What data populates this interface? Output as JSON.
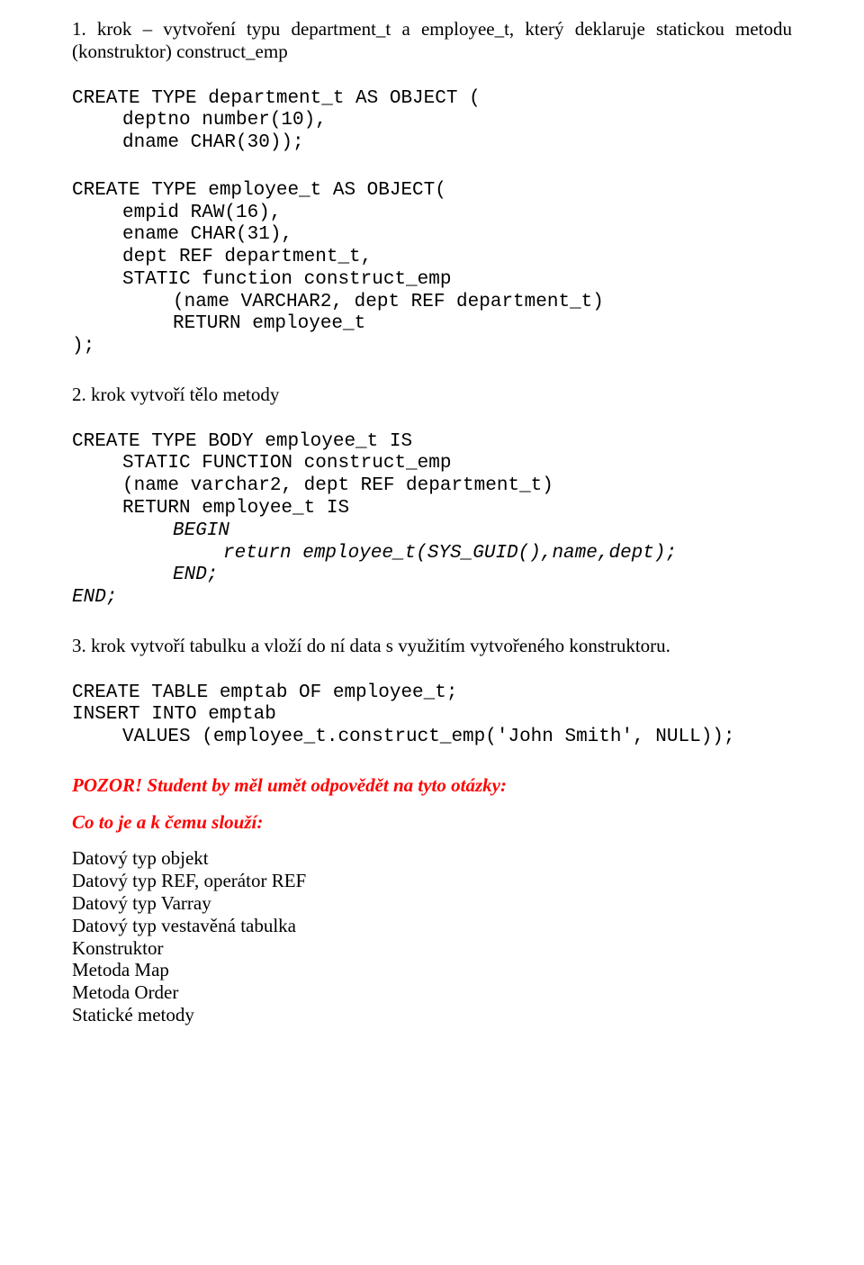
{
  "step1": {
    "intro": "1. krok – vytvoření typu department_t a employee_t, který deklaruje statickou metodu (konstruktor) construct_emp",
    "code_l1": "CREATE TYPE department_t AS OBJECT (",
    "code_l2": "deptno number(10),",
    "code_l3": "dname CHAR(30));",
    "code_l4": "CREATE TYPE employee_t AS OBJECT(",
    "code_l5": "empid RAW(16),",
    "code_l6": "ename CHAR(31),",
    "code_l7": "dept REF department_t,",
    "code_l8": "STATIC function construct_emp",
    "code_l9": "(name VARCHAR2, dept REF department_t)",
    "code_l10": "RETURN employee_t",
    "code_l11": ");"
  },
  "step2": {
    "intro": "2. krok vytvoří tělo metody",
    "code_l1": "CREATE TYPE BODY employee_t IS",
    "code_l2": "STATIC FUNCTION construct_emp",
    "code_l3": "(name varchar2, dept REF department_t)",
    "code_l4": "RETURN employee_t IS",
    "code_l5": "BEGIN",
    "code_l6": "return employee_t(SYS_GUID(),name,dept);",
    "code_l7": "END;",
    "code_l8": "END;"
  },
  "step3": {
    "intro": "3. krok vytvoří tabulku a vloží do ní data s využitím vytvořeného konstruktoru.",
    "code_l1": "CREATE TABLE emptab OF employee_t;",
    "code_l2": "INSERT INTO emptab",
    "code_l3": "VALUES (employee_t.construct_emp('John Smith', NULL));"
  },
  "questions": {
    "heading": "POZOR! Student by měl umět odpovědět na tyto otázky:",
    "subheading": "Co to je a k čemu slouží:",
    "items": {
      "i1": "Datový typ objekt",
      "i2": "Datový typ REF, operátor REF",
      "i3": "Datový typ Varray",
      "i4": "Datový typ vestavěná tabulka",
      "i5": "Konstruktor",
      "i6": "Metoda Map",
      "i7": "Metoda Order",
      "i8": "Statické metody"
    }
  }
}
